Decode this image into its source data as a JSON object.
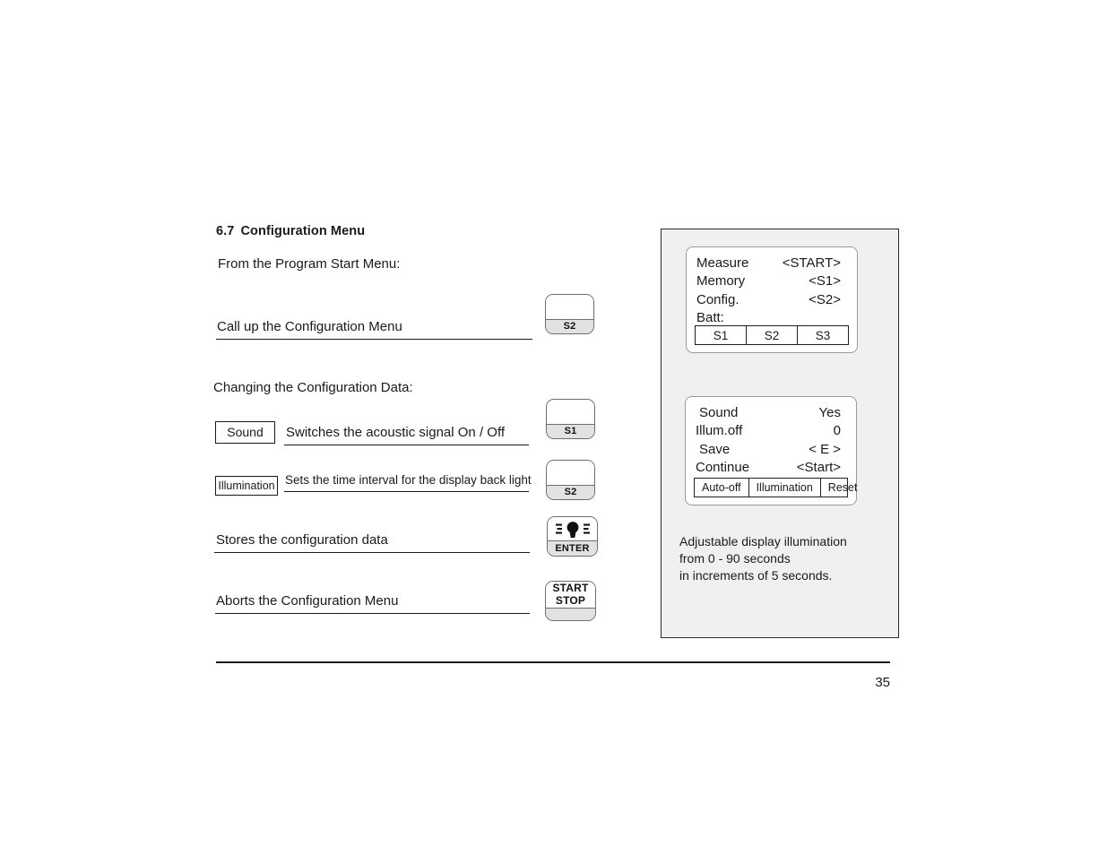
{
  "document": {
    "section_number": "6.7",
    "section_title": "Configuration Menu",
    "page_number": "35"
  },
  "left_column": {
    "intro_1": "From the Program Start Menu:",
    "intro_2": "Changing the Configuration Data:",
    "rows": [
      {
        "description": "Call up the Configuration Menu",
        "key_label": "S2"
      },
      {
        "box_label": "Sound",
        "description": "Switches the acoustic signal  On / Off",
        "key_label": "S1"
      },
      {
        "box_label": "Illumination",
        "description": "Sets the time interval for the display back light",
        "key_label": "S2"
      },
      {
        "description": "Stores the configuration data",
        "key_label": "ENTER",
        "key_icon": "lightbulb-icon"
      },
      {
        "description": "Aborts the Configuration Menu",
        "key_face_line_1": "START",
        "key_face_line_2": "STOP"
      }
    ]
  },
  "panel": {
    "display_1": {
      "rows": [
        {
          "label": "Measure",
          "value": "<START>"
        },
        {
          "label": "Memory",
          "value": "<S1>"
        },
        {
          "label": "Config.",
          "value": "<S2>"
        },
        {
          "label": "Batt:",
          "value": ""
        }
      ],
      "softkeys": [
        "S1",
        "S2",
        "S3"
      ]
    },
    "display_2": {
      "rows": [
        {
          "label": "Sound",
          "value": "Yes"
        },
        {
          "label": "Illum.off",
          "value": "0"
        },
        {
          "label": "Save",
          "value": "< E >"
        },
        {
          "label": "Continue",
          "value": "<Start>"
        }
      ],
      "softkeys": [
        "Auto-off",
        "Illumination",
        "Reset"
      ]
    },
    "note_lines": [
      "Adjustable display illumination",
      "from 0 - 90 seconds",
      "in increments of 5 seconds."
    ]
  }
}
